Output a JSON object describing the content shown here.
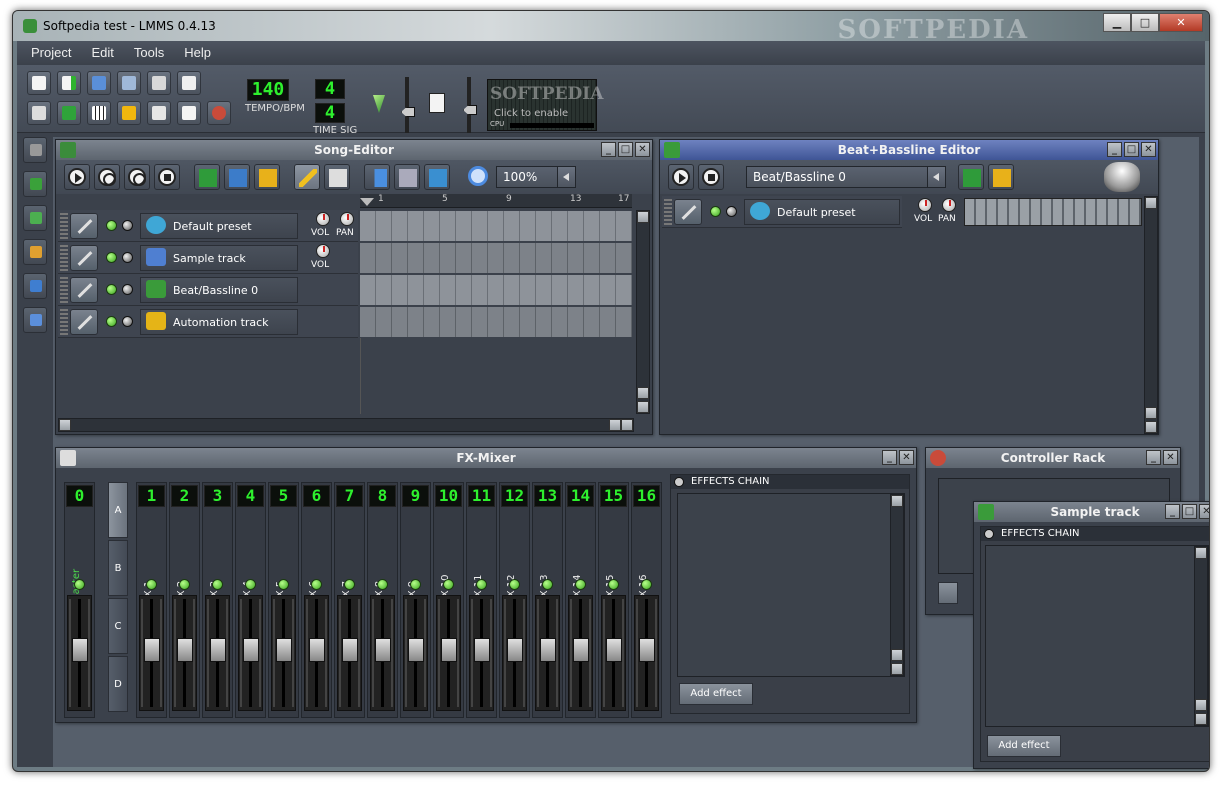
{
  "window": {
    "title": "Softpedia test - LMMS 0.4.13",
    "watermark": "SOFTPEDIA",
    "minimize": "▁",
    "maximize": "□",
    "close": "✕"
  },
  "menu": [
    "Project",
    "Edit",
    "Tools",
    "Help"
  ],
  "toolbar": {
    "tempo": {
      "value": "140",
      "label": "TEMPO/BPM"
    },
    "timesig": {
      "numerator": "4",
      "denominator": "4",
      "label": "TIME SIG"
    },
    "cpu": {
      "overlay_text": "Click to enable",
      "label": "CPU",
      "watermark": "SOFTPEDIA"
    }
  },
  "song_editor": {
    "title": "Song-Editor",
    "zoom": "100%",
    "ruler": [
      "1",
      "5",
      "9",
      "13",
      "17"
    ],
    "tracks": [
      {
        "name": "Default preset",
        "knobs": [
          "VOL",
          "PAN"
        ],
        "color": "#3fa7d6"
      },
      {
        "name": "Sample track",
        "knobs": [
          "VOL"
        ],
        "color": "#4f7fd1"
      },
      {
        "name": "Beat/Bassline 0",
        "knobs": [],
        "color": "#3a9b3a"
      },
      {
        "name": "Automation track",
        "knobs": [],
        "color": "#e5b417"
      }
    ]
  },
  "bb_editor": {
    "title": "Beat+Bassline Editor",
    "selected": "Beat/Bassline 0",
    "track": {
      "name": "Default preset",
      "knobs": [
        "VOL",
        "PAN"
      ]
    }
  },
  "fx_mixer": {
    "title": "FX-Mixer",
    "master": {
      "num": "0",
      "name": "Master"
    },
    "channels": [
      {
        "num": "1",
        "name": "FX 1"
      },
      {
        "num": "2",
        "name": "FX 2"
      },
      {
        "num": "3",
        "name": "FX 3"
      },
      {
        "num": "4",
        "name": "FX 4"
      },
      {
        "num": "5",
        "name": "FX 5"
      },
      {
        "num": "6",
        "name": "FX 6"
      },
      {
        "num": "7",
        "name": "FX 7"
      },
      {
        "num": "8",
        "name": "FX 8"
      },
      {
        "num": "9",
        "name": "FX 9"
      },
      {
        "num": "10",
        "name": "FX 10"
      },
      {
        "num": "11",
        "name": "FX 11"
      },
      {
        "num": "12",
        "name": "FX 12"
      },
      {
        "num": "13",
        "name": "FX 13"
      },
      {
        "num": "14",
        "name": "FX 14"
      },
      {
        "num": "15",
        "name": "FX 15"
      },
      {
        "num": "16",
        "name": "FX 16"
      }
    ],
    "banks": [
      "A",
      "B",
      "C",
      "D"
    ],
    "effects_chain": "EFFECTS CHAIN",
    "add_effect": "Add effect"
  },
  "controller_rack": {
    "title": "Controller Rack"
  },
  "sample_track": {
    "title": "Sample track",
    "effects_chain": "EFFECTS CHAIN",
    "add_effect": "Add effect"
  }
}
